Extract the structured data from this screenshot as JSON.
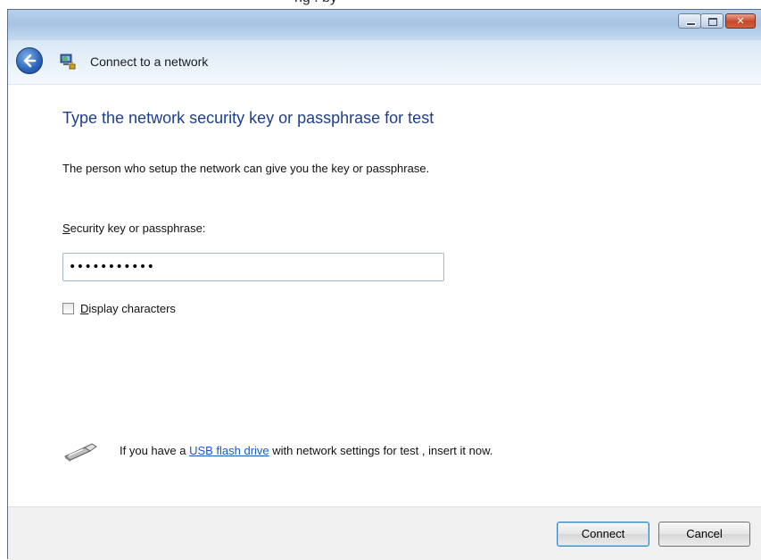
{
  "titlebar": {
    "buttons": [
      "minimize",
      "maximize",
      "close"
    ]
  },
  "nav": {
    "back_icon": "back-arrow-icon",
    "app_icon": "network-icon",
    "title": "Connect to a network"
  },
  "content": {
    "heading": "Type the network security key or passphrase for  test",
    "description": "The person who setup the network can give you the key or passphrase.",
    "field_label_accel": "S",
    "field_label_rest": "ecurity key or passphrase:",
    "password_value": "•••••••••••",
    "checkbox": {
      "checked": false,
      "label_accel": "D",
      "label_rest": "isplay characters"
    },
    "usb": {
      "icon": "usb-drive-icon",
      "text_before": "If you have a ",
      "link_text": "USB flash drive",
      "text_after": " with network settings for  test , insert it  now."
    }
  },
  "footer": {
    "connect_label": "Connect",
    "cancel_label": "Cancel"
  },
  "colors": {
    "heading": "#1e3f8a",
    "link": "#1a58c9",
    "titlebar": "#a6c3e3"
  }
}
